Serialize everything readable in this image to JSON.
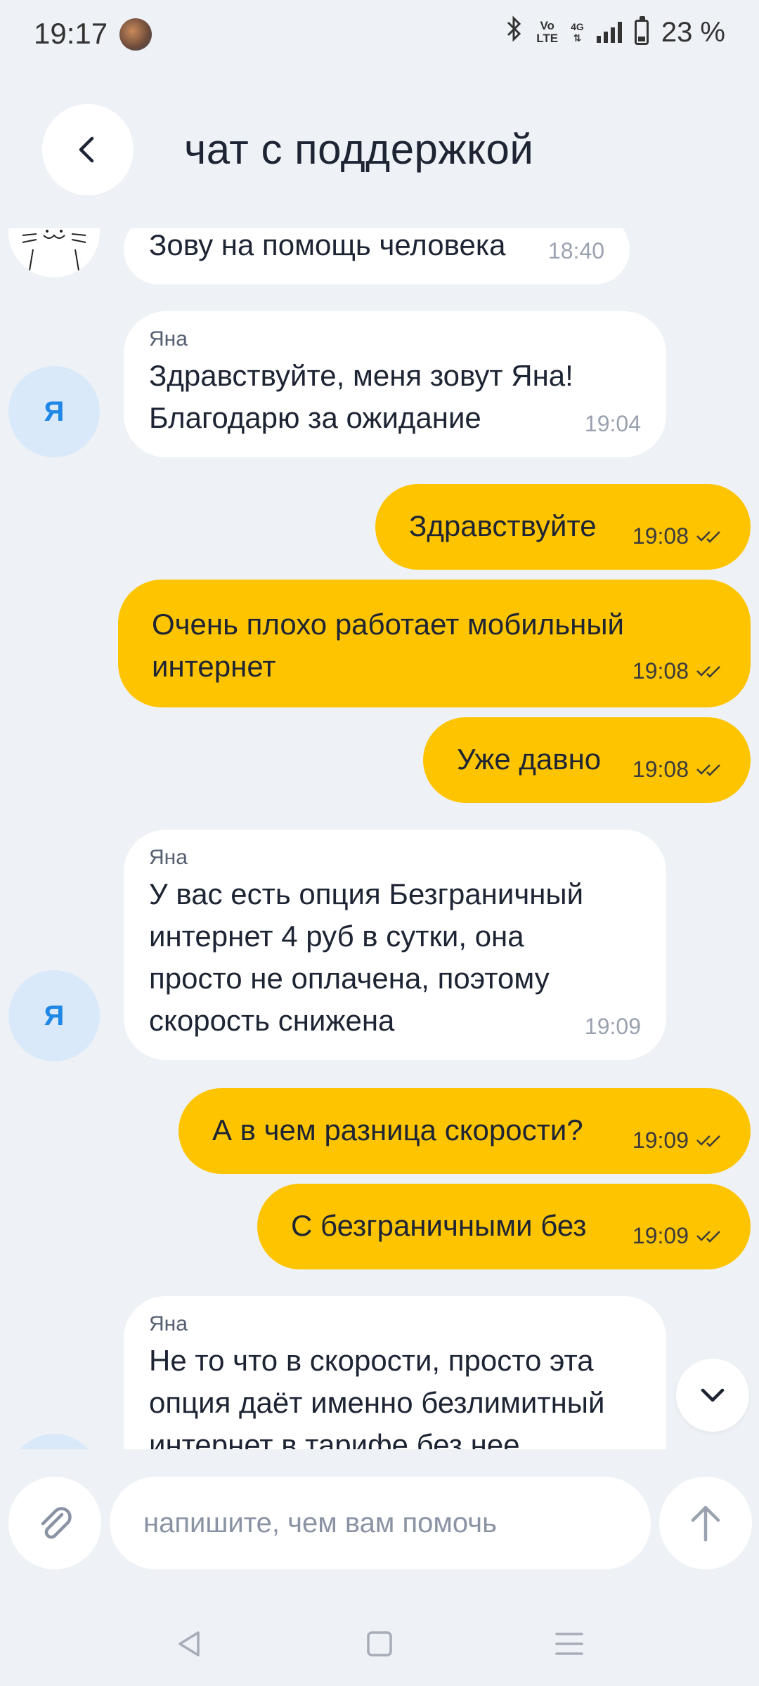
{
  "status_bar": {
    "time": "19:17",
    "network_top": "Vo",
    "network_bottom": "LTE",
    "data_type": "4G",
    "battery_text": "23 %"
  },
  "header": {
    "title": "чат с поддержкой"
  },
  "messages": [
    {
      "direction": "in",
      "author": "",
      "text": "Зову на помощь человека",
      "time": "18:40"
    },
    {
      "direction": "in",
      "author": "Яна",
      "text": "Здравствуйте, меня зовут Яна!\nБлагодарю за ожидание",
      "time": "19:04"
    },
    {
      "direction": "out",
      "text": "Здравствуйте",
      "time": "19:08"
    },
    {
      "direction": "out",
      "text": "Очень плохо работает мобильный\nинтернет",
      "time": "19:08"
    },
    {
      "direction": "out",
      "text": "Уже давно",
      "time": "19:08"
    },
    {
      "direction": "in",
      "author": "Яна",
      "text": "У вас есть опция Безграничный\nинтернет 4 руб в сутки, она\nпросто не оплачена, поэтому\nскорость снижена",
      "time": "19:09"
    },
    {
      "direction": "out",
      "text": "А в чем разница скорости?",
      "time": "19:09"
    },
    {
      "direction": "out",
      "text": "С безграничными без",
      "time": "19:09"
    },
    {
      "direction": "in",
      "author": "Яна",
      "text": "Не то что в скорости, просто эта\nопция даёт именно безлимитный\nинтернет в тарифе без нее",
      "time": ""
    }
  ],
  "agent_avatar_letter": "Я",
  "composer": {
    "placeholder": "напишите, чем вам помочь",
    "value": ""
  },
  "colors": {
    "outgoing": "#ffc400",
    "incoming": "#ffffff",
    "background": "#eef1f5",
    "avatar_bg": "#d9e9fa",
    "avatar_text": "#1f87e6"
  },
  "icons": {
    "back": "chevron-left-icon",
    "attach": "paperclip-icon",
    "send": "arrow-up-icon",
    "scroll": "chevron-down-icon",
    "read": "double-check-icon"
  }
}
